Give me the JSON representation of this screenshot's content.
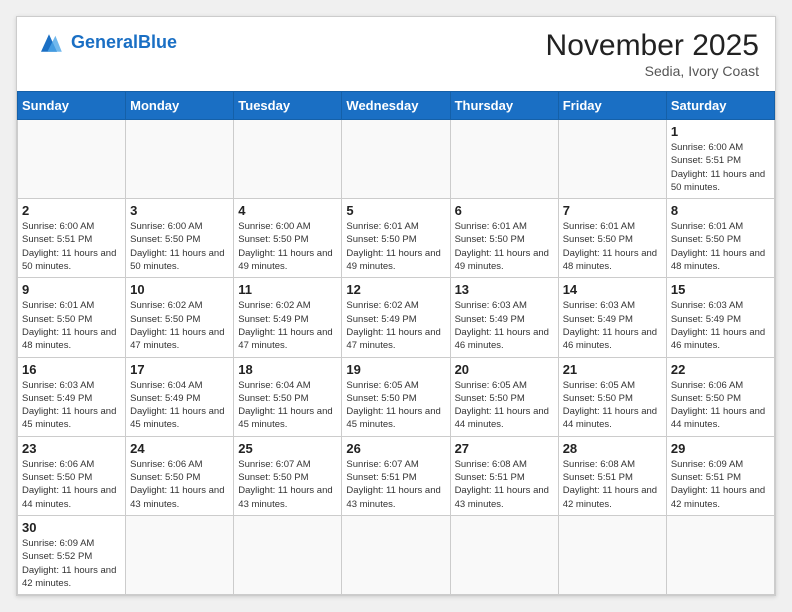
{
  "header": {
    "logo_general": "General",
    "logo_blue": "Blue",
    "month_title": "November 2025",
    "location": "Sedia, Ivory Coast"
  },
  "weekdays": [
    "Sunday",
    "Monday",
    "Tuesday",
    "Wednesday",
    "Thursday",
    "Friday",
    "Saturday"
  ],
  "weeks": [
    [
      {
        "day": "",
        "empty": true
      },
      {
        "day": "",
        "empty": true
      },
      {
        "day": "",
        "empty": true
      },
      {
        "day": "",
        "empty": true
      },
      {
        "day": "",
        "empty": true
      },
      {
        "day": "",
        "empty": true
      },
      {
        "day": "1",
        "sunrise": "Sunrise: 6:00 AM",
        "sunset": "Sunset: 5:51 PM",
        "daylight": "Daylight: 11 hours and 50 minutes."
      }
    ],
    [
      {
        "day": "2",
        "sunrise": "Sunrise: 6:00 AM",
        "sunset": "Sunset: 5:51 PM",
        "daylight": "Daylight: 11 hours and 50 minutes."
      },
      {
        "day": "3",
        "sunrise": "Sunrise: 6:00 AM",
        "sunset": "Sunset: 5:50 PM",
        "daylight": "Daylight: 11 hours and 50 minutes."
      },
      {
        "day": "4",
        "sunrise": "Sunrise: 6:00 AM",
        "sunset": "Sunset: 5:50 PM",
        "daylight": "Daylight: 11 hours and 49 minutes."
      },
      {
        "day": "5",
        "sunrise": "Sunrise: 6:01 AM",
        "sunset": "Sunset: 5:50 PM",
        "daylight": "Daylight: 11 hours and 49 minutes."
      },
      {
        "day": "6",
        "sunrise": "Sunrise: 6:01 AM",
        "sunset": "Sunset: 5:50 PM",
        "daylight": "Daylight: 11 hours and 49 minutes."
      },
      {
        "day": "7",
        "sunrise": "Sunrise: 6:01 AM",
        "sunset": "Sunset: 5:50 PM",
        "daylight": "Daylight: 11 hours and 48 minutes."
      },
      {
        "day": "8",
        "sunrise": "Sunrise: 6:01 AM",
        "sunset": "Sunset: 5:50 PM",
        "daylight": "Daylight: 11 hours and 48 minutes."
      }
    ],
    [
      {
        "day": "9",
        "sunrise": "Sunrise: 6:01 AM",
        "sunset": "Sunset: 5:50 PM",
        "daylight": "Daylight: 11 hours and 48 minutes."
      },
      {
        "day": "10",
        "sunrise": "Sunrise: 6:02 AM",
        "sunset": "Sunset: 5:50 PM",
        "daylight": "Daylight: 11 hours and 47 minutes."
      },
      {
        "day": "11",
        "sunrise": "Sunrise: 6:02 AM",
        "sunset": "Sunset: 5:49 PM",
        "daylight": "Daylight: 11 hours and 47 minutes."
      },
      {
        "day": "12",
        "sunrise": "Sunrise: 6:02 AM",
        "sunset": "Sunset: 5:49 PM",
        "daylight": "Daylight: 11 hours and 47 minutes."
      },
      {
        "day": "13",
        "sunrise": "Sunrise: 6:03 AM",
        "sunset": "Sunset: 5:49 PM",
        "daylight": "Daylight: 11 hours and 46 minutes."
      },
      {
        "day": "14",
        "sunrise": "Sunrise: 6:03 AM",
        "sunset": "Sunset: 5:49 PM",
        "daylight": "Daylight: 11 hours and 46 minutes."
      },
      {
        "day": "15",
        "sunrise": "Sunrise: 6:03 AM",
        "sunset": "Sunset: 5:49 PM",
        "daylight": "Daylight: 11 hours and 46 minutes."
      }
    ],
    [
      {
        "day": "16",
        "sunrise": "Sunrise: 6:03 AM",
        "sunset": "Sunset: 5:49 PM",
        "daylight": "Daylight: 11 hours and 45 minutes."
      },
      {
        "day": "17",
        "sunrise": "Sunrise: 6:04 AM",
        "sunset": "Sunset: 5:49 PM",
        "daylight": "Daylight: 11 hours and 45 minutes."
      },
      {
        "day": "18",
        "sunrise": "Sunrise: 6:04 AM",
        "sunset": "Sunset: 5:50 PM",
        "daylight": "Daylight: 11 hours and 45 minutes."
      },
      {
        "day": "19",
        "sunrise": "Sunrise: 6:05 AM",
        "sunset": "Sunset: 5:50 PM",
        "daylight": "Daylight: 11 hours and 45 minutes."
      },
      {
        "day": "20",
        "sunrise": "Sunrise: 6:05 AM",
        "sunset": "Sunset: 5:50 PM",
        "daylight": "Daylight: 11 hours and 44 minutes."
      },
      {
        "day": "21",
        "sunrise": "Sunrise: 6:05 AM",
        "sunset": "Sunset: 5:50 PM",
        "daylight": "Daylight: 11 hours and 44 minutes."
      },
      {
        "day": "22",
        "sunrise": "Sunrise: 6:06 AM",
        "sunset": "Sunset: 5:50 PM",
        "daylight": "Daylight: 11 hours and 44 minutes."
      }
    ],
    [
      {
        "day": "23",
        "sunrise": "Sunrise: 6:06 AM",
        "sunset": "Sunset: 5:50 PM",
        "daylight": "Daylight: 11 hours and 44 minutes."
      },
      {
        "day": "24",
        "sunrise": "Sunrise: 6:06 AM",
        "sunset": "Sunset: 5:50 PM",
        "daylight": "Daylight: 11 hours and 43 minutes."
      },
      {
        "day": "25",
        "sunrise": "Sunrise: 6:07 AM",
        "sunset": "Sunset: 5:50 PM",
        "daylight": "Daylight: 11 hours and 43 minutes."
      },
      {
        "day": "26",
        "sunrise": "Sunrise: 6:07 AM",
        "sunset": "Sunset: 5:51 PM",
        "daylight": "Daylight: 11 hours and 43 minutes."
      },
      {
        "day": "27",
        "sunrise": "Sunrise: 6:08 AM",
        "sunset": "Sunset: 5:51 PM",
        "daylight": "Daylight: 11 hours and 43 minutes."
      },
      {
        "day": "28",
        "sunrise": "Sunrise: 6:08 AM",
        "sunset": "Sunset: 5:51 PM",
        "daylight": "Daylight: 11 hours and 42 minutes."
      },
      {
        "day": "29",
        "sunrise": "Sunrise: 6:09 AM",
        "sunset": "Sunset: 5:51 PM",
        "daylight": "Daylight: 11 hours and 42 minutes."
      }
    ],
    [
      {
        "day": "30",
        "sunrise": "Sunrise: 6:09 AM",
        "sunset": "Sunset: 5:52 PM",
        "daylight": "Daylight: 11 hours and 42 minutes."
      },
      {
        "day": "",
        "empty": true
      },
      {
        "day": "",
        "empty": true
      },
      {
        "day": "",
        "empty": true
      },
      {
        "day": "",
        "empty": true
      },
      {
        "day": "",
        "empty": true
      },
      {
        "day": "",
        "empty": true
      }
    ]
  ]
}
